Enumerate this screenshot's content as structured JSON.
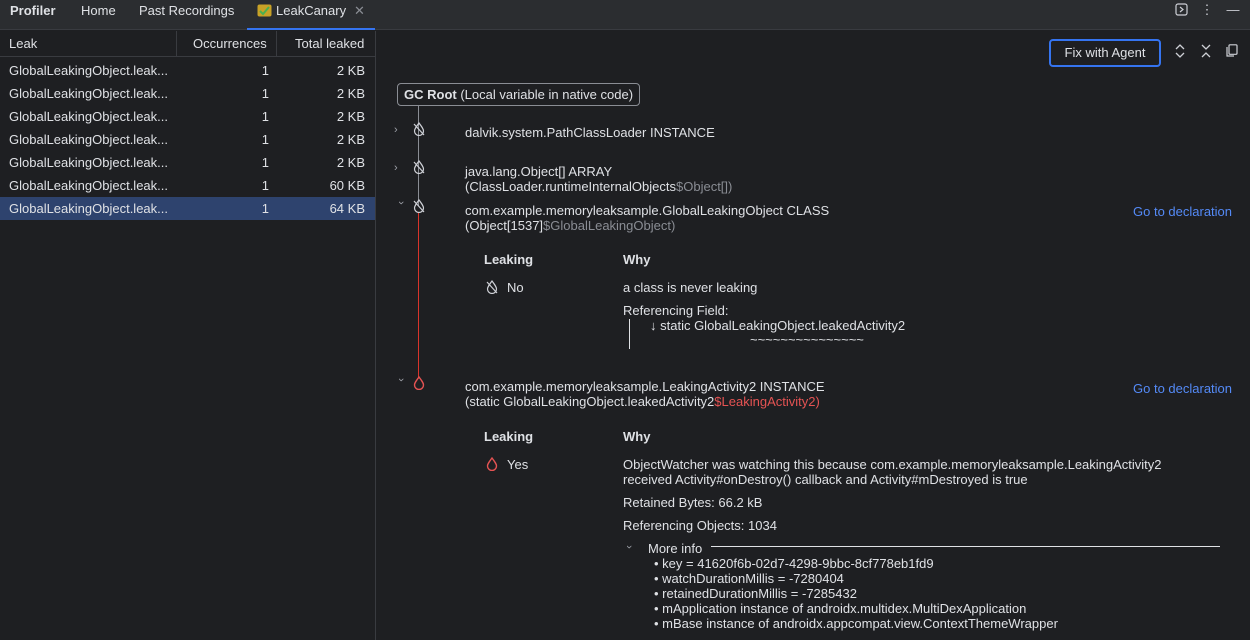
{
  "tabs": {
    "profiler": "Profiler",
    "home": "Home",
    "past_recordings": "Past Recordings",
    "leakcanary": "LeakCanary"
  },
  "table": {
    "headers": {
      "leak": "Leak",
      "occurrences": "Occurrences",
      "total_leaked": "Total leaked"
    },
    "rows": [
      {
        "leak": "GlobalLeakingObject.leak...",
        "occurrences": "1",
        "total": "2 KB"
      },
      {
        "leak": "GlobalLeakingObject.leak...",
        "occurrences": "1",
        "total": "2 KB"
      },
      {
        "leak": "GlobalLeakingObject.leak...",
        "occurrences": "1",
        "total": "2 KB"
      },
      {
        "leak": "GlobalLeakingObject.leak...",
        "occurrences": "1",
        "total": "2 KB"
      },
      {
        "leak": "GlobalLeakingObject.leak...",
        "occurrences": "1",
        "total": "2 KB"
      },
      {
        "leak": "GlobalLeakingObject.leak...",
        "occurrences": "1",
        "total": "60 KB"
      },
      {
        "leak": "GlobalLeakingObject.leak...",
        "occurrences": "1",
        "total": "64 KB"
      }
    ]
  },
  "toolbar": {
    "fix_button": "Fix with Agent"
  },
  "trace": {
    "gc_root_bold": "GC Root",
    "gc_root_rest": " (Local variable in native code)",
    "node1": {
      "line1": "dalvik.system.PathClassLoader INSTANCE"
    },
    "node2": {
      "line1": "java.lang.Object[] ARRAY",
      "line2_prefix": "(ClassLoader.runtimeInternalObjects",
      "line2_suffix": "$Object[])"
    },
    "node3": {
      "line1": "com.example.memoryleaksample.GlobalLeakingObject CLASS",
      "line2_prefix": "(Object[1537]",
      "line2_suffix": "$GlobalLeakingObject)",
      "goto": "Go to declaration",
      "leaking_header": "Leaking",
      "why_header": "Why",
      "leaking_value": "No",
      "why_text": "a class is never leaking",
      "ref_field_label": "Referencing Field:",
      "ref_field_value": "↓ static GlobalLeakingObject.leakedActivity2",
      "squiggle": "~~~~~~~~~~~~~~~"
    },
    "node4": {
      "line1": "com.example.memoryleaksample.LeakingActivity2 INSTANCE",
      "line2_prefix": "(static GlobalLeakingObject.leakedActivity2",
      "line2_suffix": "$LeakingActivity2)",
      "goto": "Go to declaration",
      "leaking_header": "Leaking",
      "why_header": "Why",
      "leaking_value": "Yes",
      "why_line1": "ObjectWatcher was watching this because com.example.memoryleaksample.LeakingActivity2",
      "why_line2": "received Activity#onDestroy() callback and Activity#mDestroyed is true",
      "retained_bytes": "Retained Bytes: 66.2 kB",
      "referencing_objects": "Referencing Objects: 1034",
      "more_info": "More info",
      "details": [
        "key = 41620f6b-02d7-4298-9bbc-8cf778eb1fd9",
        "watchDurationMillis = -7280404",
        "retainedDurationMillis = -7285432",
        "mApplication instance of androidx.multidex.MultiDexApplication",
        "mBase instance of androidx.appcompat.view.ContextThemeWrapper"
      ]
    }
  },
  "colors": {
    "accent": "#3574f0",
    "selection": "#2e436e",
    "leak_red": "#e55353",
    "link": "#548af7"
  }
}
